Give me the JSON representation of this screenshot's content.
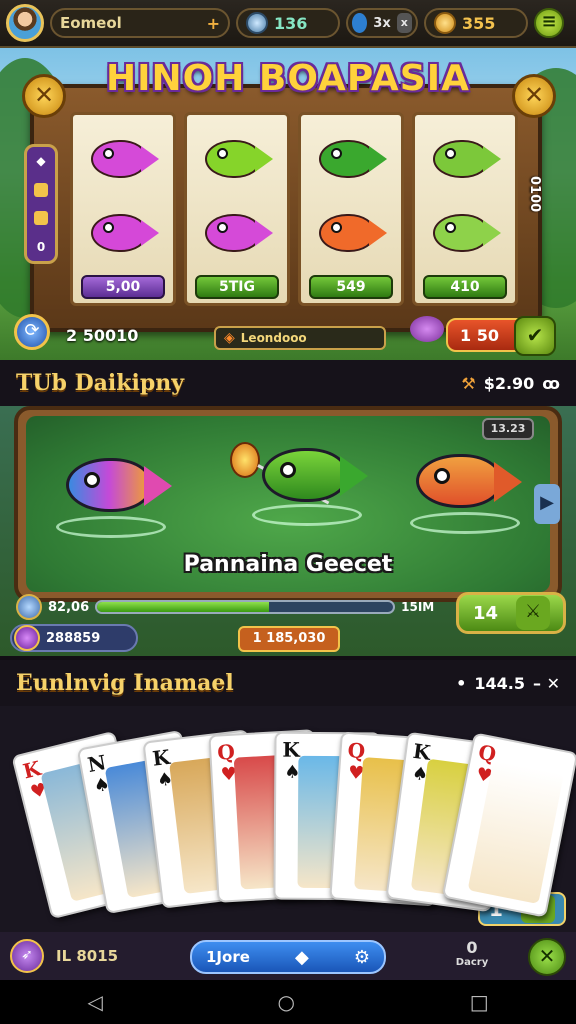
{
  "topbar": {
    "player_name": "Eomeol",
    "player_plus": "+",
    "gems": "136",
    "multiplier": "3x",
    "multiplier_close": "x",
    "coins": "355",
    "menu_glyph": "≡"
  },
  "slot": {
    "title": "HINOH BOAPASIA",
    "close_glyph": "✕",
    "reel_values": [
      "5,00",
      "5TIG",
      "549",
      "410"
    ],
    "side_panel_bottom": "0",
    "side_right_text": "0100",
    "balance_left": "2 50010",
    "mid_label": "Leondooo",
    "bet_value": "1 50",
    "fish_colors": [
      [
        "#d54ad8",
        "#d548d8"
      ],
      [
        "#86d42a",
        "#d54ad8"
      ],
      [
        "#3aa82e",
        "#f06a2a"
      ],
      [
        "#7cc83a",
        "#8ed24a"
      ]
    ]
  },
  "fishing": {
    "header_title": "TUb Daikipny",
    "header_value": "$2.90",
    "header_icon": "⚒",
    "header_glyph": "ꝏ",
    "timer": "13.23",
    "caption": "Pannaina Geecet",
    "progress_left": "82,06",
    "progress_right": "15IM",
    "progress_fraction": 0.58,
    "catch_value": "14",
    "coin_left": "288859",
    "coin_mid": "1 185,030",
    "arrow_glyph": "▶"
  },
  "cards": {
    "header_title": "Eunlnvig Inamael",
    "header_value": "144.5",
    "items": [
      {
        "rank": "K",
        "suit": "♥",
        "color": "#d02020"
      },
      {
        "rank": "N",
        "suit": "♠",
        "color": "#111"
      },
      {
        "rank": "K",
        "suit": "♠",
        "color": "#111"
      },
      {
        "rank": "Q",
        "suit": "♥",
        "color": "#d02020"
      },
      {
        "rank": "K",
        "suit": "♠",
        "color": "#111"
      },
      {
        "rank": "Q",
        "suit": "♥",
        "color": "#d02020"
      },
      {
        "rank": "K",
        "suit": "♠",
        "color": "#111"
      },
      {
        "rank": "Q",
        "suit": "♥",
        "color": "#d02020"
      }
    ],
    "counter_left": "1",
    "counter_right": "0"
  },
  "bottombar": {
    "left_value": "IL 8015",
    "center_label": "1Jore",
    "right_num": "0",
    "right_label": "Dacry",
    "close_glyph": "✕"
  },
  "nav": {
    "back": "◁",
    "home": "○",
    "recent": "□"
  }
}
